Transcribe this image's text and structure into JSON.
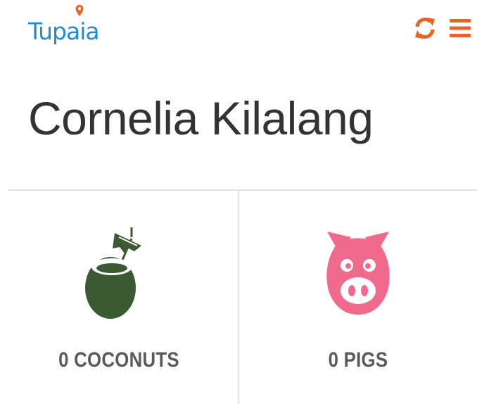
{
  "header": {
    "logo_text": "Tupaia",
    "refresh_icon": "refresh-icon",
    "menu_icon": "menu-icon"
  },
  "page": {
    "title": "Cornelia Kilalang"
  },
  "stats": [
    {
      "count": 0,
      "label": "0 COCONUTS",
      "icon": "coconut-icon"
    },
    {
      "count": 0,
      "label": "0 PIGS",
      "icon": "pig-icon"
    }
  ],
  "colors": {
    "brand_blue": "#1f8dd6",
    "accent_orange": "#e8652a",
    "coconut_green": "#3c5a32",
    "pig_pink": "#f06a8c",
    "label_gray": "#5a5a5a",
    "divider": "#e3e3e3"
  }
}
